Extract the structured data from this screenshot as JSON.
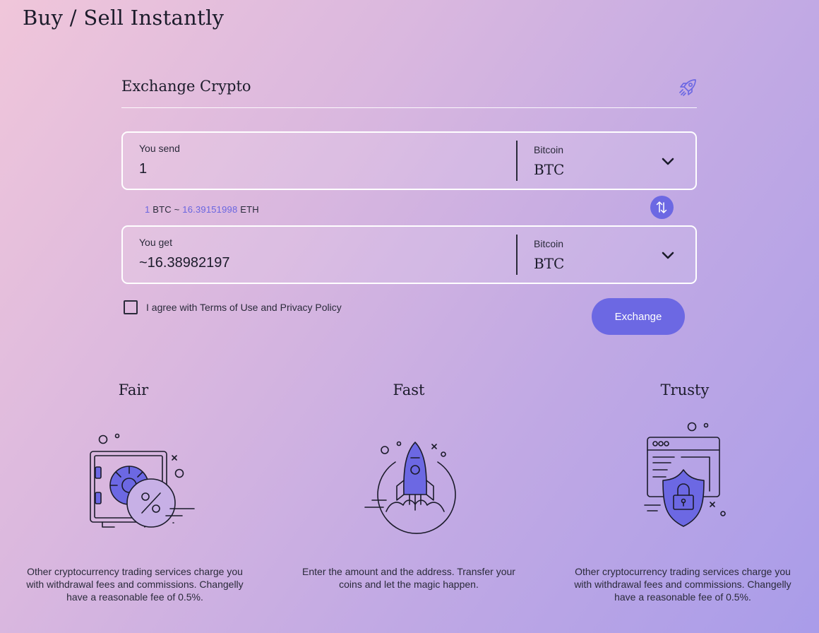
{
  "page": {
    "title": "Buy / Sell Instantly"
  },
  "exchange": {
    "title": "Exchange Crypto",
    "send": {
      "label": "You send",
      "value": "1",
      "currency_name": "Bitcoin",
      "currency_code": "BTC"
    },
    "rate": {
      "amount": "1",
      "from": "BTC",
      "sep": "~",
      "value": "16.39151998",
      "to": "ETH"
    },
    "get": {
      "label": "You get",
      "value": "~16.38982197",
      "currency_name": "Bitcoin",
      "currency_code": "BTC"
    },
    "agree_label": "I agree with Terms of Use and Privacy Policy",
    "agree_checked": false,
    "submit_label": "Exchange"
  },
  "features": [
    {
      "title": "Fair",
      "icon": "safe-percent-icon",
      "text": "Other cryptocurrency trading services charge you with withdrawal fees and commissions. Changelly have a reasonable fee of 0.5%."
    },
    {
      "title": "Fast",
      "icon": "rocket-launch-icon",
      "text": "Enter the amount and the address. Transfer your coins and let the magic happen."
    },
    {
      "title": "Trusty",
      "icon": "shield-lock-icon",
      "text": "Other cryptocurrency trading services charge you with withdrawal fees and commissions. Changelly have a reasonable fee of 0.5%."
    }
  ],
  "colors": {
    "accent": "#6c68e3",
    "accent_text": "#6a66e0",
    "ink": "#1b1b2a",
    "border": "#ffffff"
  }
}
